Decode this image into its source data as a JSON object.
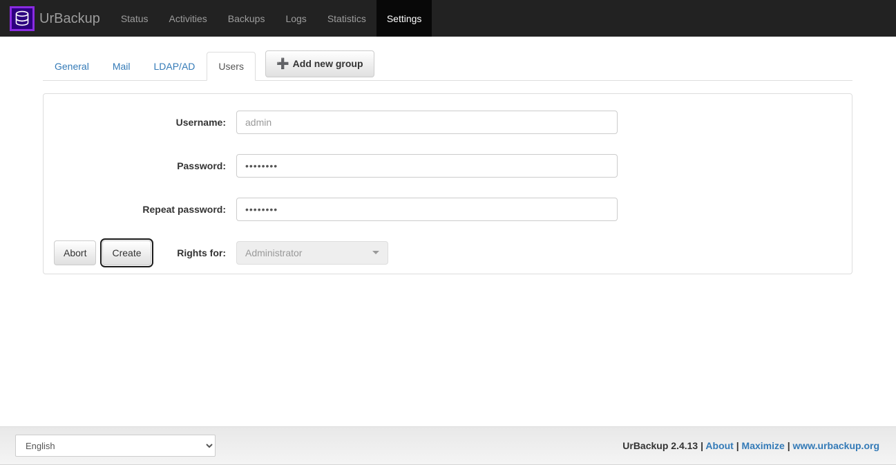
{
  "navbar": {
    "brand": "UrBackup",
    "logo_icon": "database-cylinder-icon",
    "items": [
      {
        "label": "Status",
        "active": false
      },
      {
        "label": "Activities",
        "active": false
      },
      {
        "label": "Backups",
        "active": false
      },
      {
        "label": "Logs",
        "active": false
      },
      {
        "label": "Statistics",
        "active": false
      },
      {
        "label": "Settings",
        "active": true
      }
    ],
    "bg_color": "#222222",
    "active_bg_color": "#080808"
  },
  "tabs": {
    "items": [
      {
        "label": "General",
        "active": false
      },
      {
        "label": "Mail",
        "active": false
      },
      {
        "label": "LDAP/AD",
        "active": false
      },
      {
        "label": "Users",
        "active": true
      }
    ],
    "add_group": {
      "label": "Add new group",
      "icon": "plus-icon"
    }
  },
  "form": {
    "username": {
      "label": "Username:",
      "value": "",
      "placeholder": "admin"
    },
    "password": {
      "label": "Password:",
      "value": "••••••••",
      "placeholder": ""
    },
    "repeat_password": {
      "label": "Repeat password:",
      "value": "••••••••",
      "placeholder": ""
    },
    "rights_for": {
      "label": "Rights for:",
      "value": "Administrator",
      "disabled": true
    }
  },
  "buttons": {
    "abort": "Abort",
    "create": "Create"
  },
  "footer": {
    "language": {
      "selected": "English",
      "options": [
        "English"
      ]
    },
    "version_text": "UrBackup 2.4.13",
    "sep1": "|",
    "about_link": "About",
    "sep2": "|",
    "maximize_link": "Maximize",
    "sep3": "|",
    "website_link": "www.urbackup.org",
    "link_color": "#337ab7"
  }
}
